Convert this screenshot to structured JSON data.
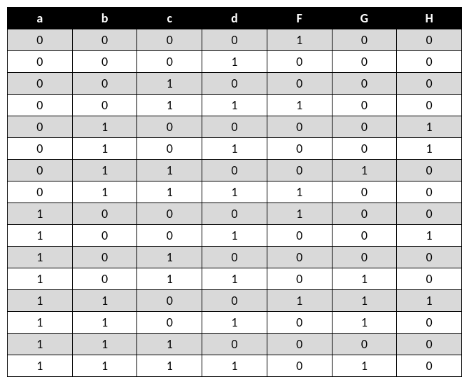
{
  "table": {
    "headers": [
      "a",
      "b",
      "c",
      "d",
      "F",
      "G",
      "H"
    ],
    "rows": [
      [
        "0",
        "0",
        "0",
        "0",
        "1",
        "0",
        "0"
      ],
      [
        "0",
        "0",
        "0",
        "1",
        "0",
        "0",
        "0"
      ],
      [
        "0",
        "0",
        "1",
        "0",
        "0",
        "0",
        "0"
      ],
      [
        "0",
        "0",
        "1",
        "1",
        "1",
        "0",
        "0"
      ],
      [
        "0",
        "1",
        "0",
        "0",
        "0",
        "0",
        "1"
      ],
      [
        "0",
        "1",
        "0",
        "1",
        "0",
        "0",
        "1"
      ],
      [
        "0",
        "1",
        "1",
        "0",
        "0",
        "1",
        "0"
      ],
      [
        "0",
        "1",
        "1",
        "1",
        "1",
        "0",
        "0"
      ],
      [
        "1",
        "0",
        "0",
        "0",
        "1",
        "0",
        "0"
      ],
      [
        "1",
        "0",
        "0",
        "1",
        "0",
        "0",
        "1"
      ],
      [
        "1",
        "0",
        "1",
        "0",
        "0",
        "0",
        "0"
      ],
      [
        "1",
        "0",
        "1",
        "1",
        "0",
        "1",
        "0"
      ],
      [
        "1",
        "1",
        "0",
        "0",
        "1",
        "1",
        "1"
      ],
      [
        "1",
        "1",
        "0",
        "1",
        "0",
        "1",
        "0"
      ],
      [
        "1",
        "1",
        "1",
        "0",
        "0",
        "0",
        "0"
      ],
      [
        "1",
        "1",
        "1",
        "1",
        "0",
        "1",
        "0"
      ]
    ]
  }
}
